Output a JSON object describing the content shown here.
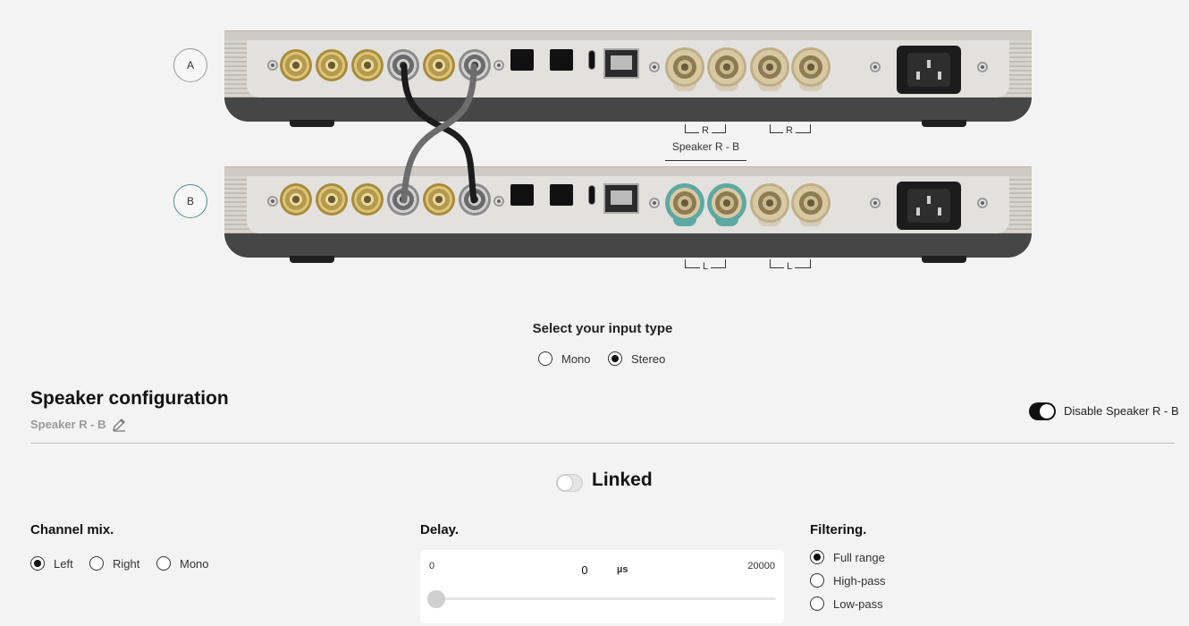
{
  "units": [
    {
      "letter": "A",
      "accent": "#9a9a9a"
    },
    {
      "letter": "B",
      "accent": "#4f8e88"
    }
  ],
  "terminal_labels": {
    "r1": "R",
    "r2": "R",
    "l1": "L",
    "l2": "L"
  },
  "speaker_diagram_label": "Speaker R - B",
  "input_type": {
    "title": "Select your input type",
    "options": [
      {
        "label": "Mono",
        "selected": false
      },
      {
        "label": "Stereo",
        "selected": true
      }
    ]
  },
  "speaker_config": {
    "title": "Speaker configuration",
    "speaker_name": "Speaker R - B",
    "disable_label": "Disable Speaker R - B",
    "disable_on": true,
    "linked_label": "Linked",
    "linked_on": false
  },
  "channel_mix": {
    "title": "Channel mix.",
    "options": [
      {
        "label": "Left",
        "selected": true
      },
      {
        "label": "Right",
        "selected": false
      },
      {
        "label": "Mono",
        "selected": false
      }
    ]
  },
  "delay": {
    "title": "Delay.",
    "min": "0",
    "max": "20000",
    "value": "0",
    "unit": "µs"
  },
  "filtering": {
    "title": "Filtering.",
    "options": [
      {
        "label": "Full range",
        "selected": true
      },
      {
        "label": "High-pass",
        "selected": false
      },
      {
        "label": "Low-pass",
        "selected": false
      }
    ]
  },
  "colors": {
    "teal_accent": "#5ea8a3",
    "toggle_on": "#111111"
  },
  "icons": {
    "edit": "pencil-icon"
  }
}
